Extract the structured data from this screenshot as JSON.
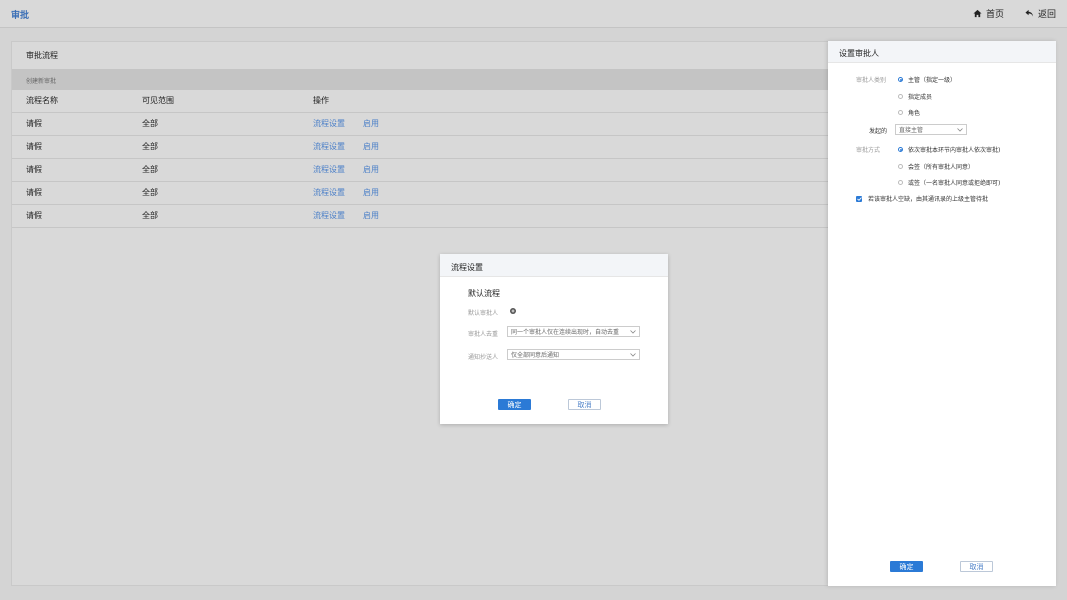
{
  "topbar": {
    "title": "审批",
    "home": "首页",
    "back": "返回"
  },
  "main": {
    "panel_title": "审批流程",
    "subbar": "创建新审批",
    "columns": [
      "流程名称",
      "可见范围",
      "操作"
    ],
    "rows": [
      {
        "name": "请假",
        "scope": "全部",
        "action1": "流程设置",
        "action2": "启用"
      },
      {
        "name": "请假",
        "scope": "全部",
        "action1": "流程设置",
        "action2": "启用"
      },
      {
        "name": "请假",
        "scope": "全部",
        "action1": "流程设置",
        "action2": "启用"
      },
      {
        "name": "请假",
        "scope": "全部",
        "action1": "流程设置",
        "action2": "启用"
      },
      {
        "name": "请假",
        "scope": "全部",
        "action1": "流程设置",
        "action2": "启用"
      }
    ]
  },
  "drawer": {
    "title": "设置审批人",
    "approver_type_label": "审批人类别",
    "approver_types": [
      "主管（指定一级）",
      "指定成员",
      "角色"
    ],
    "initiator_label": "发起的",
    "initiator_value": "直接主管",
    "approval_mode_label": "审批方式",
    "approval_modes": [
      "依次审批本环节内审批人依次审批)",
      "会签（所有审批人同意）",
      "或签（一名审批人同意或拒绝即可)"
    ],
    "checkbox_label": "若该审批人空缺，由其通讯录的上级主管待批",
    "ok": "确定",
    "cancel": "取消"
  },
  "modal": {
    "title": "流程设置",
    "subtitle": "默认流程",
    "default_approver_label": "默认审批人",
    "dedupe_label": "审批人去重",
    "dedupe_value": "同一个审批人仅在连续出现时，自动去重",
    "notify_label": "通知抄送人",
    "notify_value": "仅全部同意后通知",
    "ok": "确定",
    "cancel": "取消"
  }
}
